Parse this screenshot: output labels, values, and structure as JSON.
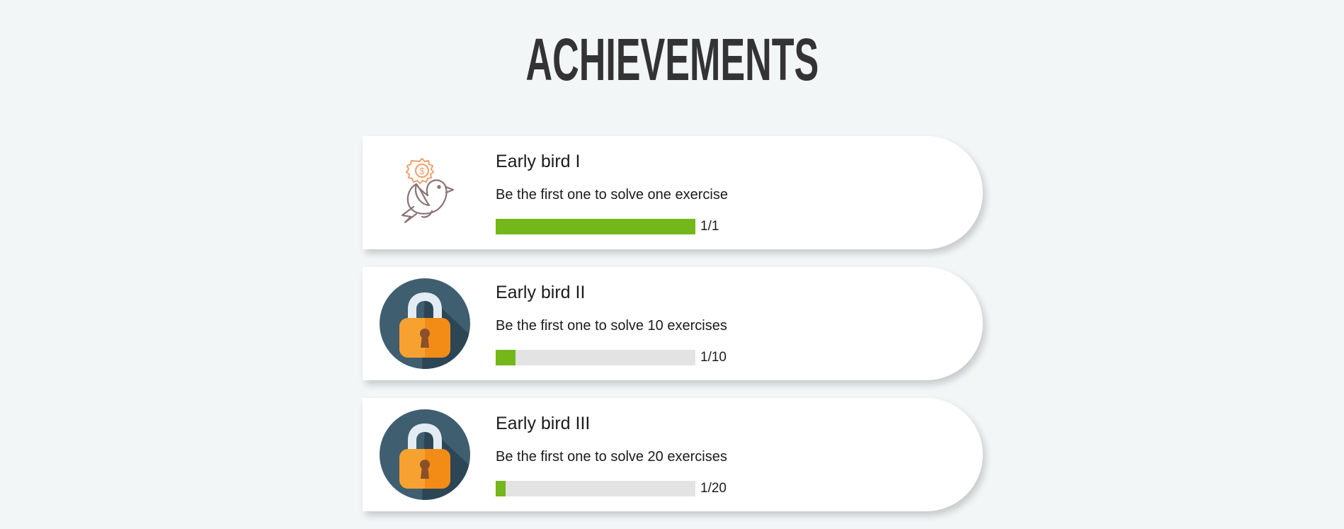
{
  "page": {
    "title": "ACHIEVEMENTS"
  },
  "achievements": [
    {
      "title": "Early bird I",
      "description": "Be the first one to solve one exercise",
      "progress_text": "1/1",
      "progress_fraction": 1.0,
      "icon": "bird-coin-icon",
      "unlocked": true
    },
    {
      "title": "Early bird II",
      "description": "Be the first one to solve 10 exercises",
      "progress_text": "1/10",
      "progress_fraction": 0.1,
      "icon": "padlock-icon",
      "unlocked": false
    },
    {
      "title": "Early bird III",
      "description": "Be the first one to solve 20 exercises",
      "progress_text": "1/20",
      "progress_fraction": 0.05,
      "icon": "padlock-icon",
      "unlocked": false
    }
  ],
  "colors": {
    "background": "#f2f6f7",
    "card": "#ffffff",
    "progress_fill": "#74b71b",
    "progress_track": "#e3e3e3",
    "title": "#333333",
    "lock_circle": "#3f5e70",
    "lock_body": "#f7a230"
  }
}
